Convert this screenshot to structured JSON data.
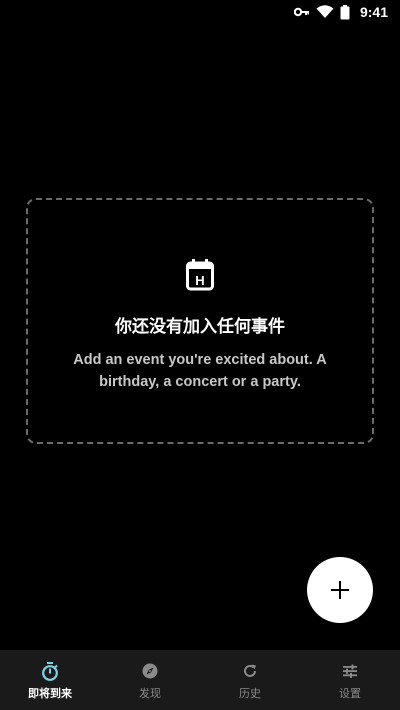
{
  "status_bar": {
    "time": "9:41",
    "icons": [
      "key-icon",
      "wifi-icon",
      "battery-icon"
    ]
  },
  "empty_state": {
    "icon": "calendar-holiday-icon",
    "icon_letter": "H",
    "title": "你还没有加入任何事件",
    "description": "Add an event you're excited about. A birthday, a concert or a party."
  },
  "fab": {
    "icon": "plus-icon"
  },
  "bottom_nav": {
    "items": [
      {
        "label": "即将到来",
        "icon": "timer-icon",
        "active": true
      },
      {
        "label": "发现",
        "icon": "compass-icon",
        "active": false
      },
      {
        "label": "历史",
        "icon": "history-icon",
        "active": false
      },
      {
        "label": "设置",
        "icon": "sliders-icon",
        "active": false
      }
    ]
  },
  "colors": {
    "background": "#000000",
    "nav_background": "#1a1a1a",
    "accent": "#7ed3e6",
    "dashed_border": "#6b6b6b",
    "inactive": "#8a8a8a"
  }
}
